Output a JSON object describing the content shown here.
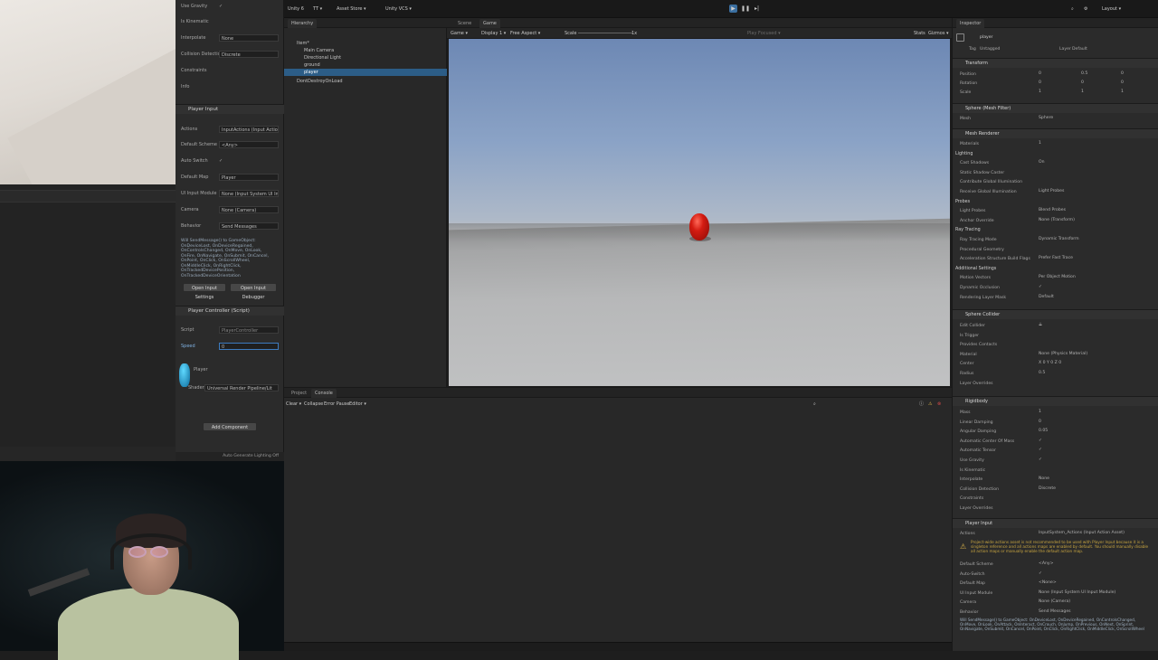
{
  "toolbar": {
    "account": "Unity 6",
    "cloud": "TT ▾",
    "asset_store": "Asset Store ▾",
    "vcs": "Unity VCS ▾",
    "layout": "Layout ▾"
  },
  "left_inspector": {
    "rows": [
      {
        "label": "Use Gravity",
        "value": "✓"
      },
      {
        "label": "Is Kinematic",
        "value": ""
      },
      {
        "label": "Interpolate",
        "value": "None"
      },
      {
        "label": "Collision Detection",
        "value": "Discrete"
      },
      {
        "label": "Constraints",
        "value": ""
      },
      {
        "label": "Info",
        "value": ""
      }
    ],
    "player_input": {
      "title": "Player Input",
      "rows": [
        {
          "label": "Actions",
          "value": "InputActions (Input Action Asset)"
        },
        {
          "label": "Default Scheme",
          "value": "<Any>"
        },
        {
          "label": "Auto Switch",
          "value": "✓"
        },
        {
          "label": "Default Map",
          "value": "Player"
        },
        {
          "label": "UI Input Module",
          "value": "None (Input System UI Input Module)"
        },
        {
          "label": "Camera",
          "value": "None (Camera)"
        },
        {
          "label": "Behavior",
          "value": "Send Messages"
        }
      ],
      "info": "Will SendMessage() to GameObject: OnDeviceLost, OnDeviceRegained, OnControlsChanged, OnMove, OnLook, OnFire, OnNavigate, OnSubmit, OnCancel, OnPoint, OnClick, OnScrollWheel, OnMiddleClick, OnRightClick, OnTrackedDevicePosition, OnTrackedDeviceOrientation",
      "btn_settings": "Open Input Settings",
      "btn_debugger": "Open Input Debugger"
    },
    "player_controller": {
      "title": "Player Controller (Script)",
      "script_label": "Script",
      "script_value": "PlayerController",
      "speed_label": "Speed",
      "speed_value": "0"
    },
    "material": {
      "name": "Player",
      "shader_label": "Shader",
      "shader_value": "Universal Render Pipeline/Lit"
    },
    "add_component": "Add Component",
    "auto_generate": "Auto Generate Lighting Off"
  },
  "hierarchy": {
    "tab": "Hierarchy",
    "items": [
      {
        "label": "Item*",
        "indent": 0
      },
      {
        "label": "Main Camera",
        "indent": 1
      },
      {
        "label": "Directional Light",
        "indent": 1
      },
      {
        "label": "ground",
        "indent": 1
      },
      {
        "label": "player",
        "indent": 1,
        "selected": true
      },
      {
        "label": "DontDestroyOnLoad",
        "indent": 0
      }
    ]
  },
  "game": {
    "tab_scene": "Scene",
    "tab_game": "Game",
    "toolbar": {
      "mode": "Game ▾",
      "display": "Display 1 ▾",
      "aspect": "Free Aspect ▾",
      "scale_label": "Scale",
      "scale_value": "1x",
      "play_focused": "Play Focused ▾",
      "stats": "Stats",
      "gizmos": "Gizmos ▾"
    }
  },
  "console": {
    "tab_project": "Project",
    "tab_console": "Console",
    "clear": "Clear ▾",
    "collapse": "Collapse",
    "error_pause": "Error Pause",
    "editor": "Editor ▾"
  },
  "inspector": {
    "tab": "Inspector",
    "object_name": "player",
    "tag_label": "Tag",
    "tag_value": "Untagged",
    "layer_label": "Layer",
    "layer_value": "Default",
    "transform": {
      "title": "Transform",
      "position": {
        "label": "Position",
        "x": "0",
        "y": "0.5",
        "z": "0"
      },
      "rotation": {
        "label": "Rotation",
        "x": "0",
        "y": "0",
        "z": "0"
      },
      "scale": {
        "label": "Scale",
        "x": "1",
        "y": "1",
        "z": "1"
      }
    },
    "mesh_filter": {
      "title": "Sphere (Mesh Filter)",
      "mesh_label": "Mesh",
      "mesh_value": "Sphere"
    },
    "mesh_renderer": {
      "title": "Mesh Renderer",
      "rows": [
        {
          "label": "Materials",
          "value": "1"
        },
        {
          "label": "Lighting",
          "value": "",
          "section": true
        },
        {
          "label": "Cast Shadows",
          "value": "On"
        },
        {
          "label": "Static Shadow Caster",
          "value": ""
        },
        {
          "label": "Contribute Global Illumination",
          "value": ""
        },
        {
          "label": "Receive Global Illumination",
          "value": "Light Probes"
        },
        {
          "label": "Probes",
          "value": "",
          "section": true
        },
        {
          "label": "Light Probes",
          "value": "Blend Probes"
        },
        {
          "label": "Anchor Override",
          "value": "None (Transform)"
        },
        {
          "label": "Ray Tracing",
          "value": "",
          "section": true
        },
        {
          "label": "Ray Tracing Mode",
          "value": "Dynamic Transform"
        },
        {
          "label": "Procedural Geometry",
          "value": ""
        },
        {
          "label": "Acceleration Structure Build Flags",
          "value": "Prefer Fast Trace"
        },
        {
          "label": "Additional Settings",
          "value": "",
          "section": true
        },
        {
          "label": "Motion Vectors",
          "value": "Per Object Motion"
        },
        {
          "label": "Dynamic Occlusion",
          "value": "✓"
        },
        {
          "label": "Rendering Layer Mask",
          "value": "Default"
        }
      ]
    },
    "sphere_collider": {
      "title": "Sphere Collider",
      "rows": [
        {
          "label": "Edit Collider",
          "value": "⟁"
        },
        {
          "label": "Is Trigger",
          "value": ""
        },
        {
          "label": "Provides Contacts",
          "value": ""
        },
        {
          "label": "Material",
          "value": "None (Physics Material)"
        },
        {
          "label": "Center",
          "value": "X 0   Y 0   Z 0"
        },
        {
          "label": "Radius",
          "value": "0.5"
        },
        {
          "label": "Layer Overrides",
          "value": ""
        }
      ]
    },
    "rigidbody": {
      "title": "Rigidbody",
      "rows": [
        {
          "label": "Mass",
          "value": "1"
        },
        {
          "label": "Linear Damping",
          "value": "0"
        },
        {
          "label": "Angular Damping",
          "value": "0.05"
        },
        {
          "label": "Automatic Center Of Mass",
          "value": "✓"
        },
        {
          "label": "Automatic Tensor",
          "value": "✓"
        },
        {
          "label": "Use Gravity",
          "value": "✓"
        },
        {
          "label": "Is Kinematic",
          "value": ""
        },
        {
          "label": "Interpolate",
          "value": "None"
        },
        {
          "label": "Collision Detection",
          "value": "Discrete"
        },
        {
          "label": "Constraints",
          "value": ""
        },
        {
          "label": "Layer Overrides",
          "value": ""
        }
      ]
    },
    "player_input": {
      "title": "Player Input",
      "actions_label": "Actions",
      "actions_value": "InputSystem_Actions (Input Action Asset)",
      "warning": "Project-wide actions asset is not recommended to be used with Player Input because it is a singleton reference and all actions maps are enabled by default. You should manually disable all action maps or manually enable the default action map.",
      "rows": [
        {
          "label": "Default Scheme",
          "value": "<Any>"
        },
        {
          "label": "Auto-Switch",
          "value": "✓"
        },
        {
          "label": "Default Map",
          "value": "<None>"
        },
        {
          "label": "UI Input Module",
          "value": "None (Input System UI Input Module)"
        },
        {
          "label": "Camera",
          "value": "None (Camera)"
        },
        {
          "label": "Behavior",
          "value": "Send Messages"
        }
      ],
      "info": "Will SendMessage() to GameObject: OnDeviceLost, OnDeviceRegained, OnControlsChanged, OnMove, OnLook, OnAttack, OnInteract, OnCrouch, OnJump, OnPrevious, OnNext, OnSprint, OnNavigate, OnSubmit, OnCancel, OnPoint, OnClick, OnRightClick, OnMiddleClick, OnScrollWheel"
    }
  },
  "colors": {
    "accent": "#2c5d87",
    "ball": "#d41c12",
    "sky_top": "#6d88b4",
    "ground": "#b7b8b9"
  }
}
